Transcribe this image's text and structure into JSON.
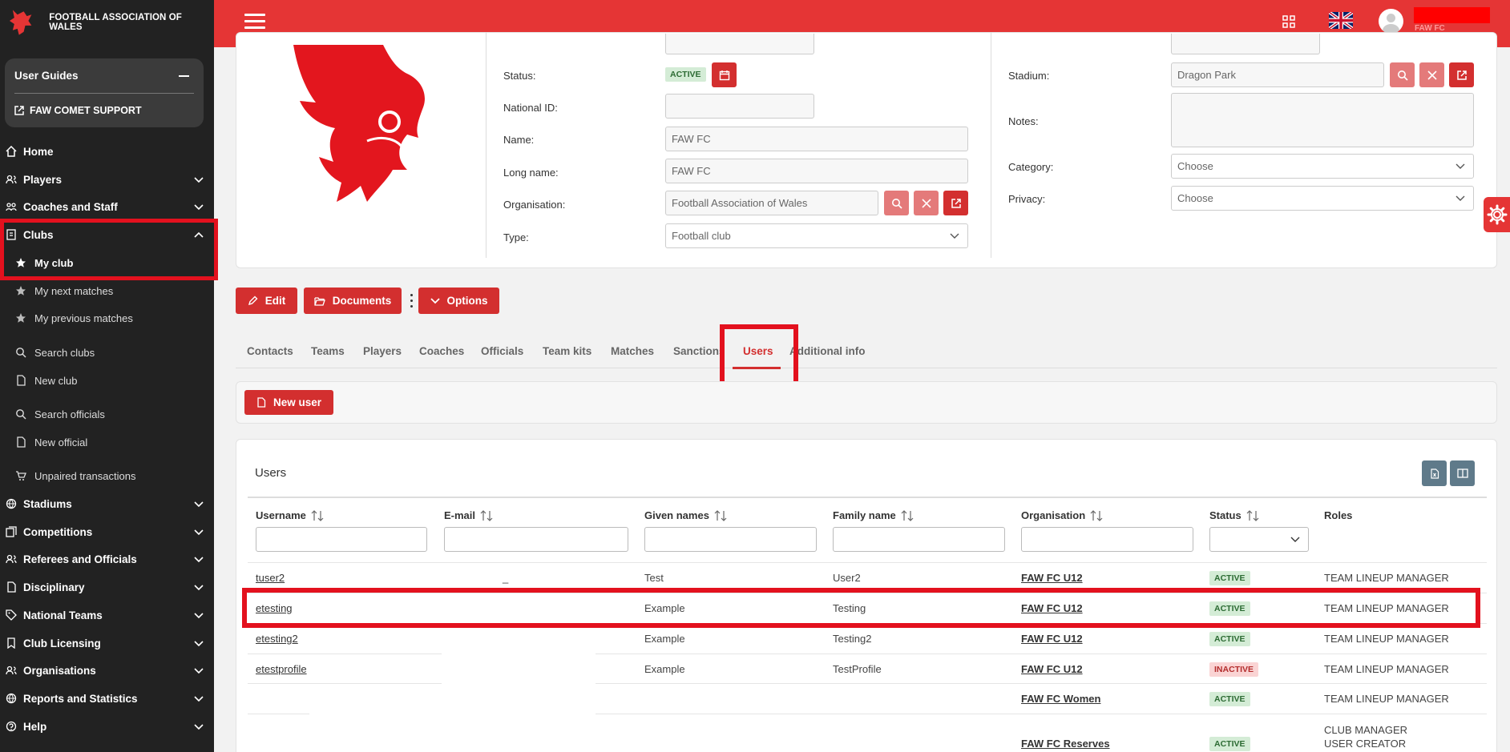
{
  "brand": {
    "name": "FOOTBALL ASSOCIATION OF WALES"
  },
  "user_guides": {
    "title": "User Guides",
    "support": "FAW COMET SUPPORT"
  },
  "nav": {
    "home": "Home",
    "players": "Players",
    "coaches": "Coaches and Staff",
    "clubs": "Clubs",
    "my_club": "My club",
    "next_matches": "My next matches",
    "prev_matches": "My previous matches",
    "search_clubs": "Search clubs",
    "new_club": "New club",
    "search_officials": "Search officials",
    "new_official": "New official",
    "unpaired": "Unpaired transactions",
    "stadiums": "Stadiums",
    "competitions": "Competitions",
    "referees": "Referees and Officials",
    "disciplinary": "Disciplinary",
    "national_teams": "National Teams",
    "licensing": "Club Licensing",
    "organisations": "Organisations",
    "reports": "Reports and Statistics",
    "help": "Help"
  },
  "topbar": {
    "user_club": "FAW FC"
  },
  "club": {
    "status_label": "Status:",
    "status_value": "ACTIVE",
    "national_id_label": "National ID:",
    "national_id_value": "",
    "name_label": "Name:",
    "name_value": "FAW FC",
    "long_name_label": "Long name:",
    "long_name_value": "FAW FC",
    "organisation_label": "Organisation:",
    "organisation_value": "Football Association of Wales",
    "type_label": "Type:",
    "type_value": "Football club",
    "stadium_label": "Stadium:",
    "stadium_value": "Dragon Park",
    "notes_label": "Notes:",
    "category_label": "Category:",
    "category_value": "Choose",
    "privacy_label": "Privacy:",
    "privacy_value": "Choose"
  },
  "actions": {
    "edit": "Edit",
    "documents": "Documents",
    "options": "Options"
  },
  "tabs": [
    "Contacts",
    "Teams",
    "Players",
    "Coaches",
    "Officials",
    "Team kits",
    "Matches",
    "Sanctions",
    "Users",
    "Additional info"
  ],
  "new_user": "New user",
  "users_table": {
    "title": "Users",
    "columns": [
      "Username",
      "E-mail",
      "Given names",
      "Family name",
      "Organisation",
      "Status",
      "Roles"
    ],
    "rows": [
      {
        "username": "tuser2",
        "email": "_",
        "given": "Test",
        "family": "User2",
        "org": "FAW FC U12",
        "status": "ACTIVE",
        "roles": "TEAM LINEUP MANAGER"
      },
      {
        "username": "etesting",
        "email": "",
        "given": "Example",
        "family": "Testing",
        "org": "FAW FC U12",
        "status": "ACTIVE",
        "roles": "TEAM LINEUP MANAGER"
      },
      {
        "username": "etesting2",
        "email": "",
        "given": "Example",
        "family": "Testing2",
        "org": "FAW FC U12",
        "status": "ACTIVE",
        "roles": "TEAM LINEUP MANAGER"
      },
      {
        "username": "etestprofile",
        "email": "",
        "given": "Example",
        "family": "TestProfile",
        "org": "FAW FC U12",
        "status": "INACTIVE",
        "roles": "TEAM LINEUP MANAGER"
      },
      {
        "username": "",
        "email": "",
        "given": "",
        "family": "",
        "org": "FAW FC Women",
        "status": "ACTIVE",
        "roles": "TEAM LINEUP MANAGER"
      },
      {
        "username": "",
        "email": "",
        "given": "",
        "family": "",
        "org": "FAW FC Reserves",
        "status": "ACTIVE",
        "roles": "CLUB MANAGER",
        "roles2": "USER CREATOR"
      }
    ]
  },
  "colors": {
    "primary": "#e53535",
    "button": "#d32f2f",
    "sidebar": "#222222",
    "highlight": "#e3111e"
  }
}
